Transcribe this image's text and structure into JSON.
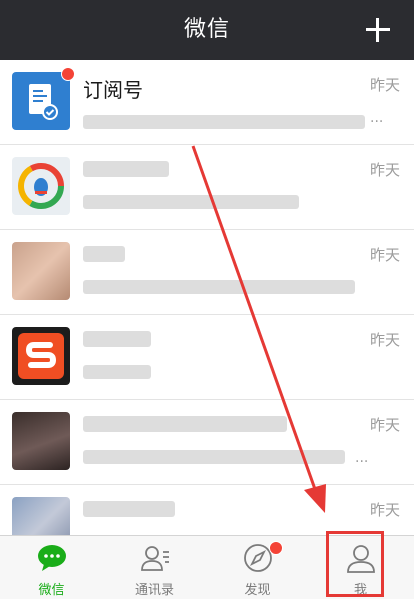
{
  "header": {
    "title": "微信"
  },
  "chats": [
    {
      "name": "订阅号",
      "time": "昨天",
      "preview": "...",
      "badge": true
    },
    {
      "name": "",
      "time": "昨天",
      "preview": ""
    },
    {
      "name": "",
      "time": "昨天",
      "preview": ""
    },
    {
      "name": "",
      "time": "昨天",
      "preview": ""
    },
    {
      "name": "",
      "time": "昨天",
      "preview": "..."
    },
    {
      "name": "",
      "time": "昨天",
      "preview": ""
    }
  ],
  "tabs": [
    {
      "label": "微信",
      "icon": "chat-bubble-icon",
      "active": true
    },
    {
      "label": "通讯录",
      "icon": "contacts-icon"
    },
    {
      "label": "发现",
      "icon": "compass-icon",
      "badge": true
    },
    {
      "label": "我",
      "icon": "person-icon"
    }
  ],
  "colors": {
    "active": "#1aad19",
    "header": "#2b2c30",
    "badge": "#f44336",
    "annotation": "#e53935"
  }
}
